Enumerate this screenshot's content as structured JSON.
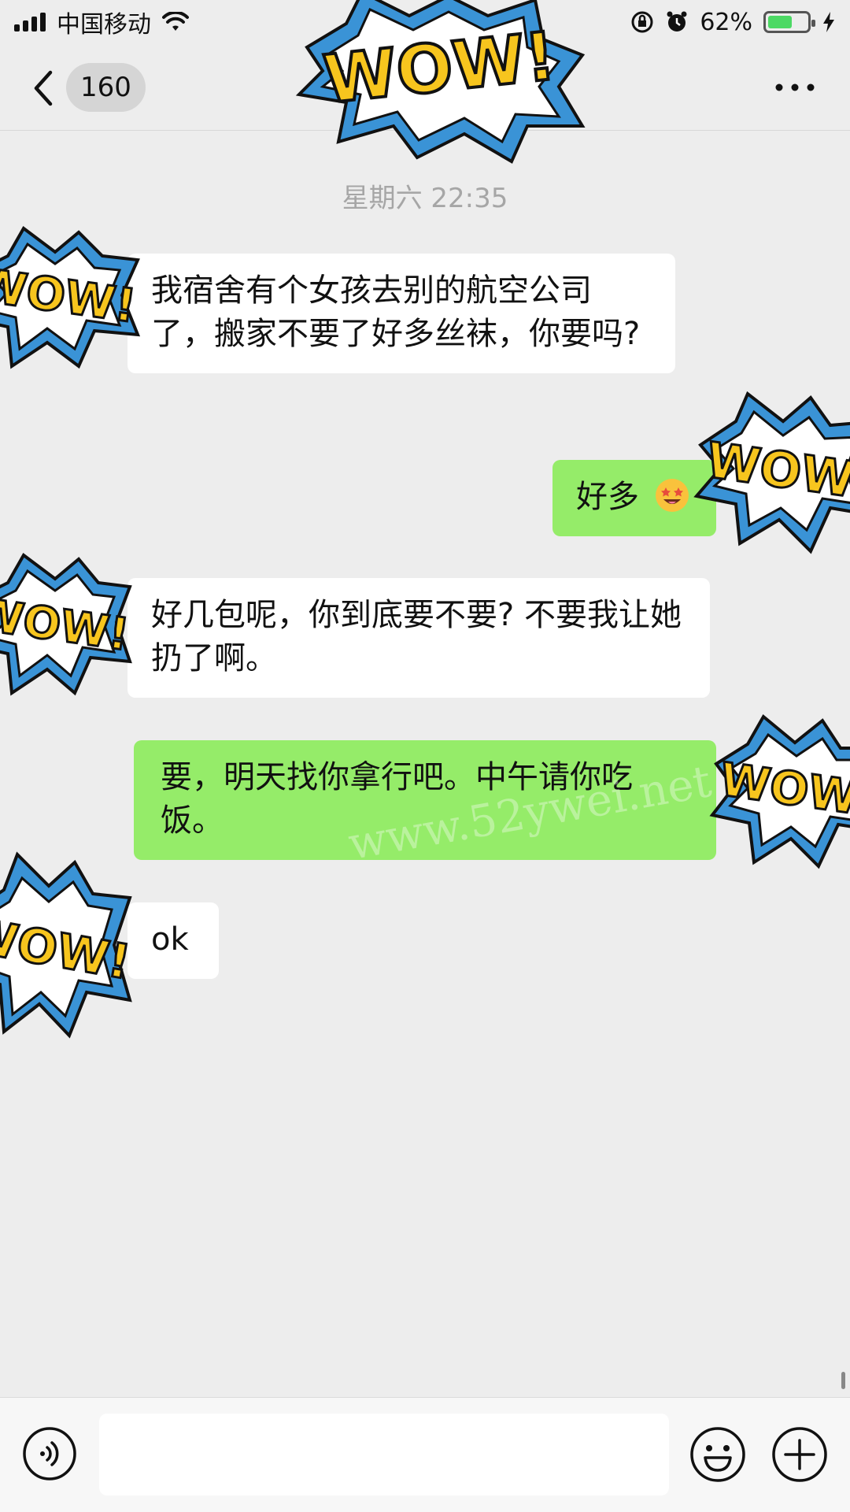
{
  "status_bar": {
    "carrier": "中国移动",
    "battery_percent": "62%",
    "battery_level": 0.62,
    "battery_color": "#4cd964"
  },
  "nav": {
    "unread_count": "160",
    "back_icon": "chevron-left-icon",
    "more_icon": "more-dots-icon"
  },
  "chat": {
    "timestamp": "星期六 22:35",
    "messages": [
      {
        "sender": "them",
        "text": "我宿舍有个女孩去别的航空公司了，搬家不要了好多丝袜，你要吗?"
      },
      {
        "sender": "me",
        "text": "好多"
      },
      {
        "sender": "them",
        "text": "好几包呢，你到底要不要? 不要我让她扔了啊。"
      },
      {
        "sender": "me",
        "text": "要，明天找你拿行吧。中午请你吃饭。"
      },
      {
        "sender": "them",
        "text": "ok"
      }
    ],
    "sticker_text": "WOW!"
  },
  "input_bar": {
    "voice_icon": "voice-icon",
    "emoji_icon": "emoji-icon",
    "plus_icon": "plus-icon",
    "input_value": ""
  },
  "watermark": "www.52ywei.net",
  "colors": {
    "bg": "#ededed",
    "incoming_bubble": "#ffffff",
    "outgoing_bubble": "#95ec69",
    "sticker_yellow": "#f7c51e",
    "sticker_blue": "#3a93d6"
  }
}
